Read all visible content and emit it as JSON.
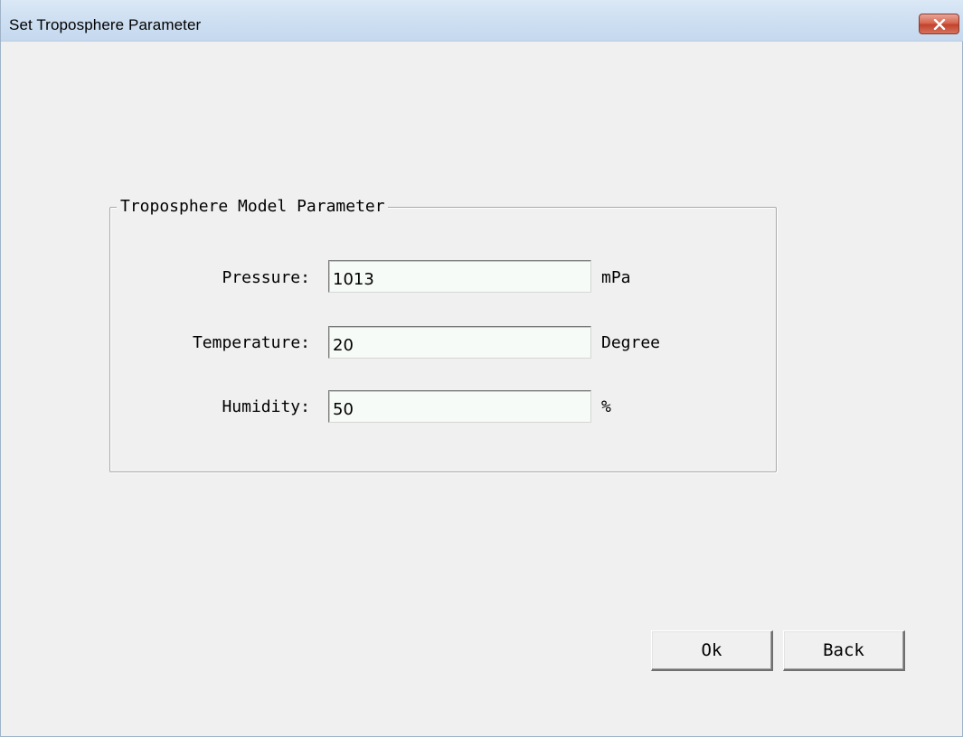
{
  "window": {
    "title": "Set Troposphere Parameter",
    "close_icon": "close-icon"
  },
  "group": {
    "legend": "Troposphere Model Parameter"
  },
  "fields": [
    {
      "label": "Pressure:",
      "value": "1013",
      "unit": "mPa"
    },
    {
      "label": "Temperature:",
      "value": "20",
      "unit": "Degree"
    },
    {
      "label": "Humidity:",
      "value": "50",
      "unit": "%"
    }
  ],
  "buttons": {
    "ok_label": "Ok",
    "back_label": "Back"
  },
  "colors": {
    "titlebar": "#cfe0f2",
    "close_button": "#c94a35",
    "dialog_background": "#f0f0f0",
    "input_background": "#f7fbf7"
  }
}
